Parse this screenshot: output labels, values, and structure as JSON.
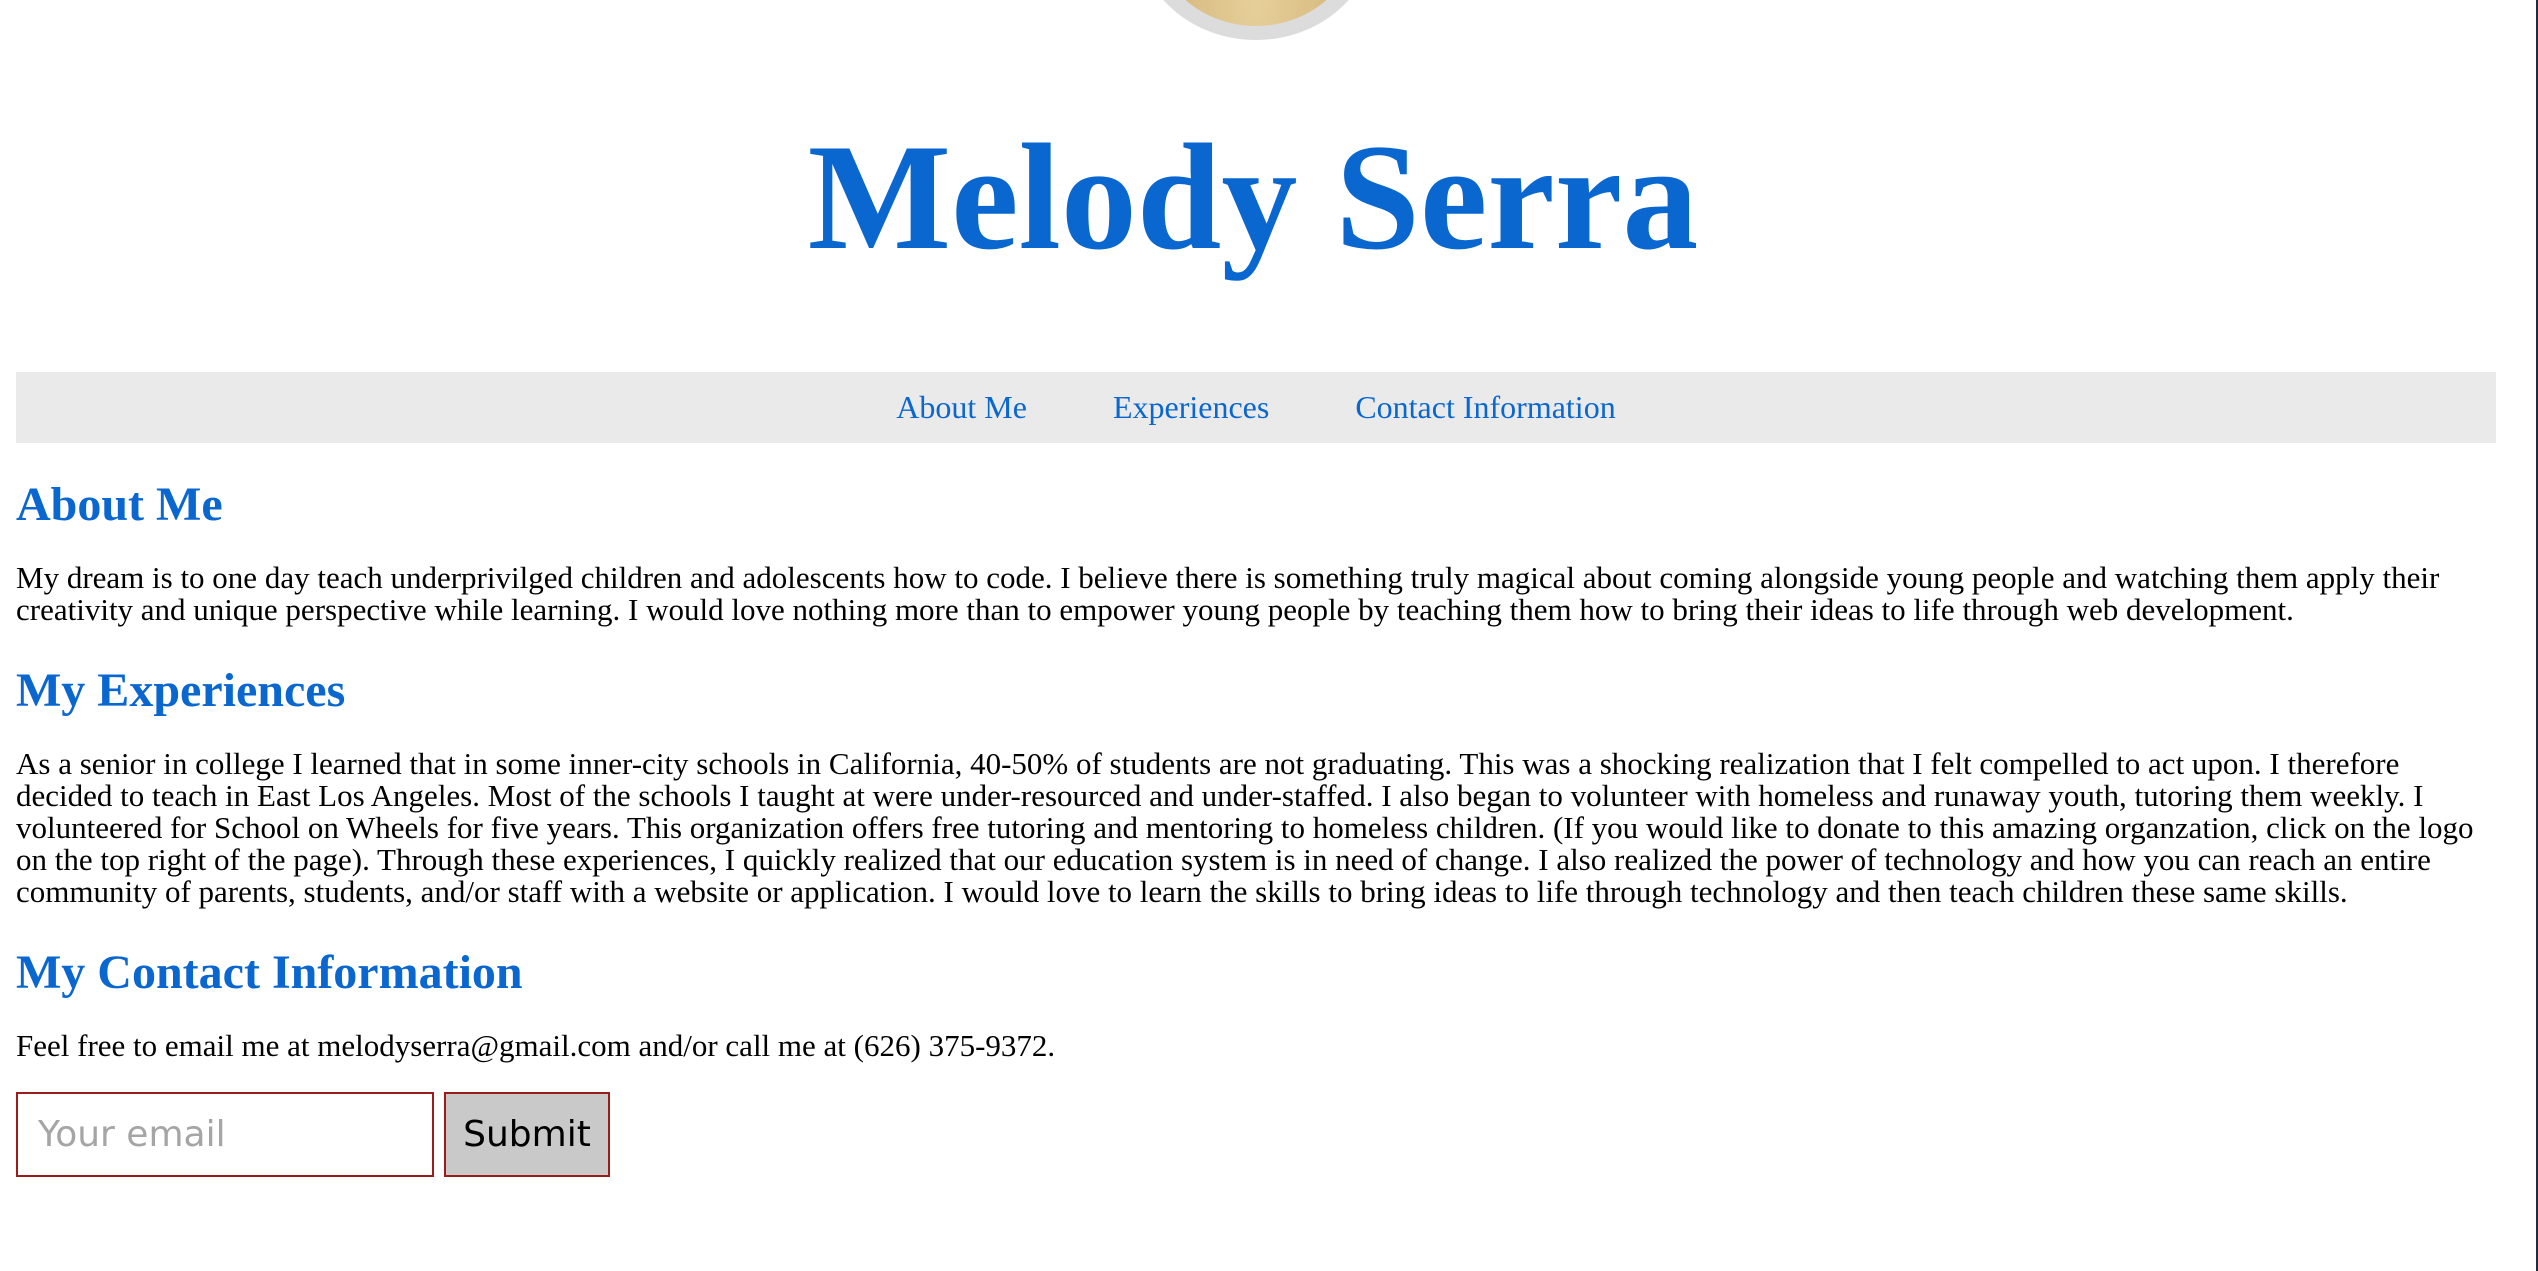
{
  "header": {
    "name": "Melody Serra"
  },
  "nav": {
    "items": [
      {
        "label": "About Me"
      },
      {
        "label": "Experiences"
      },
      {
        "label": "Contact Information"
      }
    ]
  },
  "sections": {
    "about": {
      "heading": "About Me",
      "text": "My dream is to one day teach underprivilged children and adolescents how to code. I believe there is something truly magical about coming alongside young people and watching them apply their creativity and unique perspective while learning. I would love nothing more than to empower young people by teaching them how to bring their ideas to life through web development."
    },
    "experiences": {
      "heading": "My Experiences",
      "text": "As a senior in college I learned that in some inner-city schools in California, 40-50% of students are not graduating. This was a shocking realization that I felt compelled to act upon. I therefore decided to teach in East Los Angeles. Most of the schools I taught at were under-resourced and under-staffed. I also began to volunteer with homeless and runaway youth, tutoring them weekly. I volunteered for School on Wheels for five years. This organization offers free tutoring and mentoring to homeless children. (If you would like to donate to this amazing organzation, click on the logo on the top right of the page). Through these experiences, I quickly realized that our education system is in need of change. I also realized the power of technology and how you can reach an entire community of parents, students, and/or staff with a website or application. I would love to learn the skills to bring ideas to life through technology and then teach children these same skills."
    },
    "contact": {
      "heading": "My Contact Information",
      "text": "Feel free to email me at melodyserra@gmail.com and/or call me at (626) 375-9372."
    }
  },
  "form": {
    "email_placeholder": "Your email",
    "email_value": "",
    "submit_label": "Submit"
  },
  "colors": {
    "accent": "#0a67cf",
    "nav_background": "#eaeaea",
    "form_border": "#9b1c1c",
    "button_background": "#c9c9c9"
  }
}
